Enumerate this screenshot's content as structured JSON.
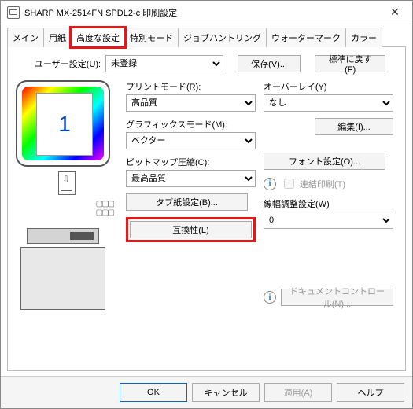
{
  "title": "SHARP MX-2514FN SPDL2-c 印刷設定",
  "tabs": [
    "メイン",
    "用紙",
    "高度な設定",
    "特別モード",
    "ジョブハントリング",
    "ウォーターマーク",
    "カラー"
  ],
  "selected_tab_index": 2,
  "user_settings": {
    "label": "ユーザー設定(U):",
    "value": "未登録",
    "save": "保存(V)...",
    "restore": "標準に戻す(F)"
  },
  "preview": {
    "page_number": "1"
  },
  "print_mode": {
    "label": "プリントモード(R):",
    "value": "高品質"
  },
  "graphics_mode": {
    "label": "グラフィックスモード(M):",
    "value": "ベクター"
  },
  "bitmap": {
    "label": "ビットマップ圧縮(C):",
    "value": "最高品質"
  },
  "tab_paper_btn": "タブ紙設定(B)...",
  "compat_btn": "互換性(L)",
  "overlay": {
    "label": "オーバーレイ(Y)",
    "value": "なし",
    "edit": "編集(I)..."
  },
  "font_btn": "フォント設定(O)...",
  "linked_print": "連結印刷(T)",
  "linewidth": {
    "label": "線幅調整設定(W)",
    "value": "0"
  },
  "doc_control": "ドキュメントコントロール(N)...",
  "footer": {
    "ok": "OK",
    "cancel": "キャンセル",
    "apply": "適用(A)",
    "help": "ヘルプ"
  }
}
